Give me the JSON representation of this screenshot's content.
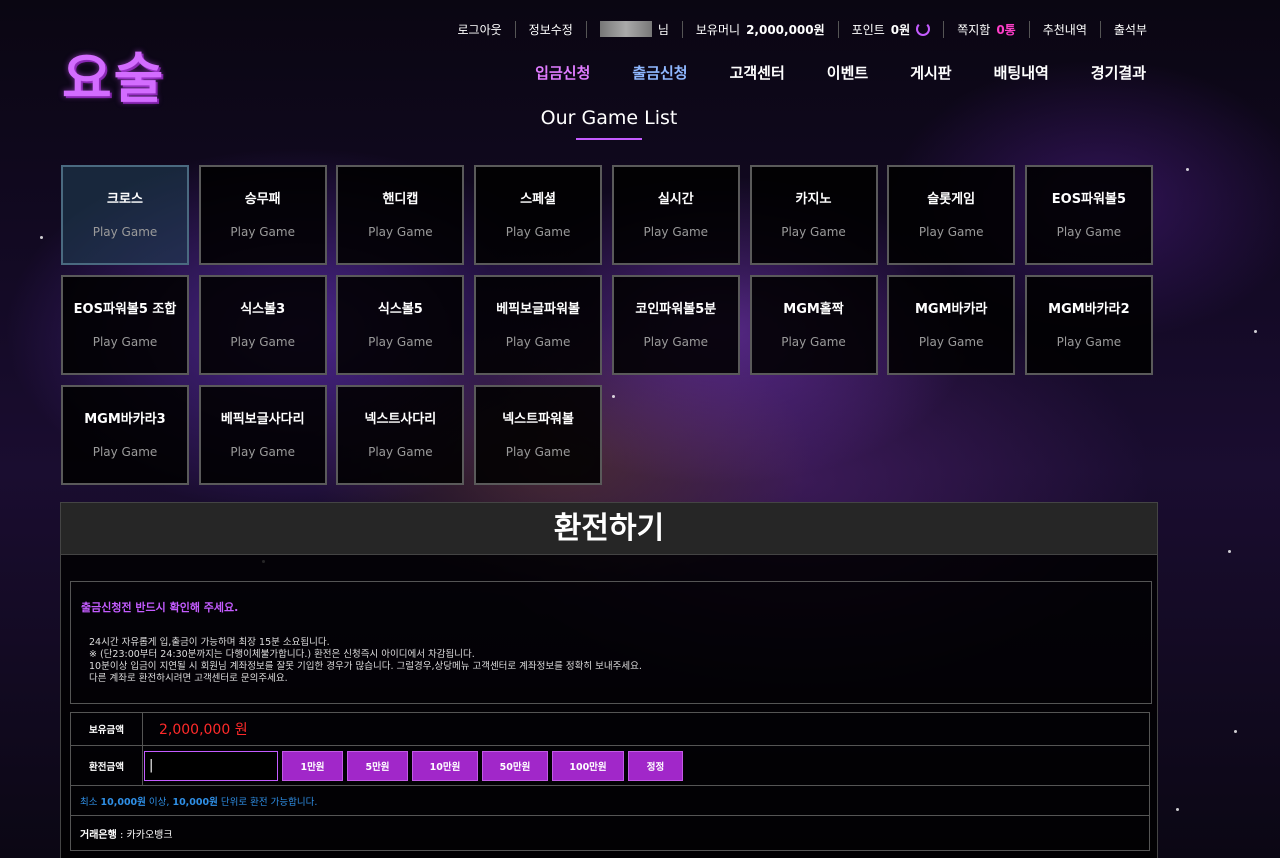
{
  "logo": "요술",
  "topbar": {
    "logout": "로그아웃",
    "edit_info": "정보수정",
    "user_suffix": "님",
    "holding_label": "보유머니",
    "holding_value": "2,000,000원",
    "point_label": "포인트",
    "point_value": "0원",
    "message_label": "쪽지함",
    "message_count": "0통",
    "referral": "추천내역",
    "attendance": "출석부"
  },
  "nav": [
    {
      "label": "입금신청"
    },
    {
      "label": "출금신청"
    },
    {
      "label": "고객센터"
    },
    {
      "label": "이벤트"
    },
    {
      "label": "게시판"
    },
    {
      "label": "배팅내역"
    },
    {
      "label": "경기결과"
    }
  ],
  "game_list_title": "Our Game List",
  "play_label": "Play Game",
  "games": [
    {
      "name": "크로스"
    },
    {
      "name": "승무패"
    },
    {
      "name": "핸디캡"
    },
    {
      "name": "스페셜"
    },
    {
      "name": "실시간"
    },
    {
      "name": "카지노"
    },
    {
      "name": "슬롯게임"
    },
    {
      "name": "EOS파워볼5"
    },
    {
      "name": "EOS파워볼5 조합"
    },
    {
      "name": "식스볼3"
    },
    {
      "name": "식스볼5"
    },
    {
      "name": "베픽보글파워볼"
    },
    {
      "name": "코인파워볼5분"
    },
    {
      "name": "MGM홀짝"
    },
    {
      "name": "MGM바카라"
    },
    {
      "name": "MGM바카라2"
    },
    {
      "name": "MGM바카라3"
    },
    {
      "name": "베픽보글사다리"
    },
    {
      "name": "넥스트사다리"
    },
    {
      "name": "넥스트파워볼"
    }
  ],
  "exchange": {
    "title": "환전하기",
    "notice_title": "출금신청전 반드시 확인해 주세요.",
    "notice_lines": [
      "24시간 자유롭게 입,출금이 가능하며 최장 15분 소요됩니다.",
      "※ (단23:00부터 24:30분까지는 다행이체불가합니다.) 환전은 신청즉시 아이디에서 차감됩니다.",
      "10분이상 입금이 지연될 시 회원님 계좌정보를 잘못 기입한 경우가 많습니다. 그럴경우,상당메뉴 고객센터로 계좌정보를 정확히 보내주세요.",
      "다른 계좌로 환전하시려면 고객센터로 문의주세요."
    ],
    "holding_label": "보유금액",
    "holding_amount": "2,000,000 원",
    "amount_label": "환전금액",
    "amount_value": "|",
    "buttons": [
      {
        "label": "1만원"
      },
      {
        "label": "5만원"
      },
      {
        "label": "10만원"
      },
      {
        "label": "50만원"
      },
      {
        "label": "100만원"
      },
      {
        "label": "정정"
      }
    ],
    "min_note_1": "최소 ",
    "min_note_2": "10,000원",
    "min_note_3": " 이상, ",
    "min_note_4": "10,000원",
    "min_note_5": "  단위로 환전 가능합니다.",
    "bank_label": "거래은행",
    "bank_value": " : 카카오뱅크"
  },
  "colors": {
    "accent": "#c45cff",
    "button": "#a127c9",
    "money": "#ff2a2a",
    "note": "#2f8fe6"
  }
}
